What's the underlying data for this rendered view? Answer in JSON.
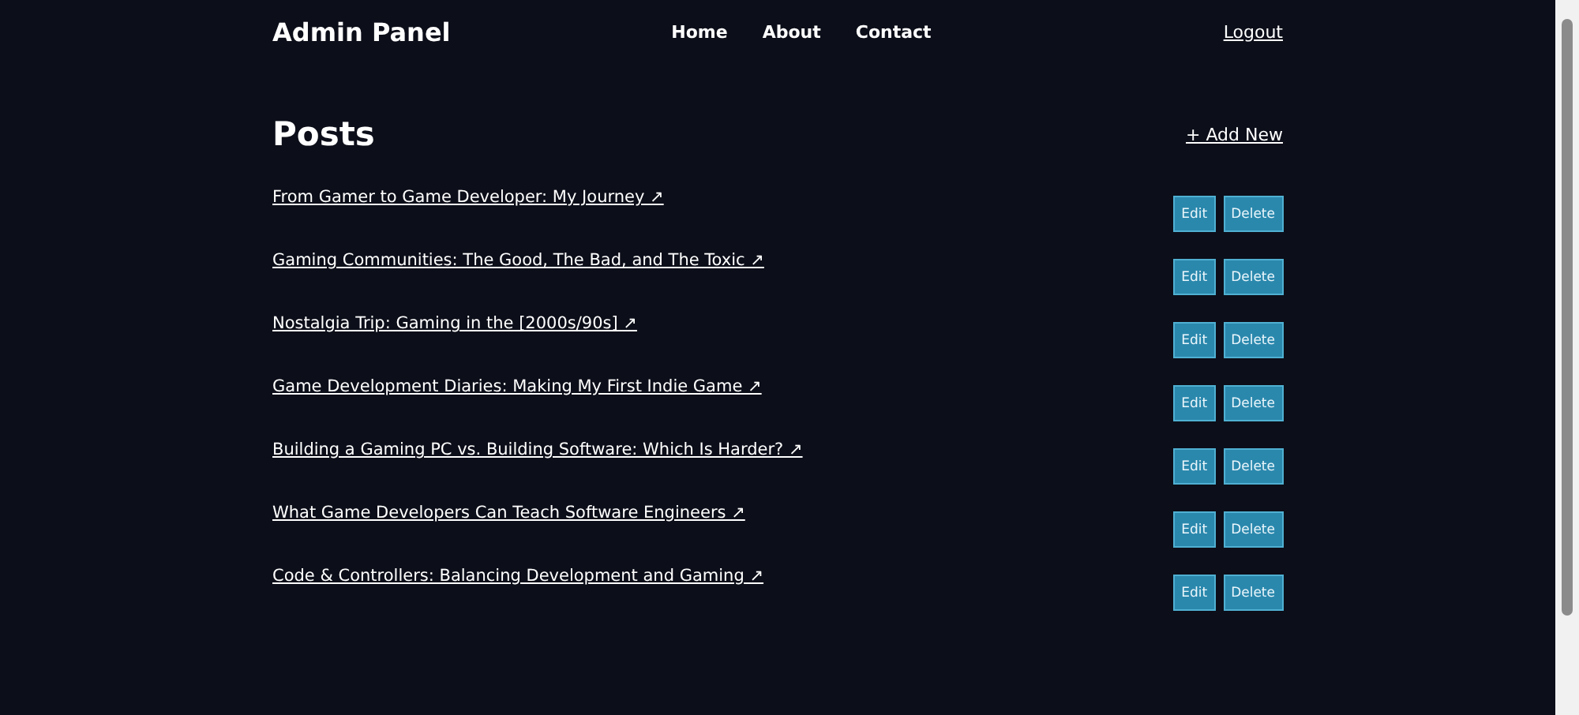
{
  "header": {
    "brand": "Admin Panel",
    "nav": [
      "Home",
      "About",
      "Contact"
    ],
    "logout": "Logout"
  },
  "page": {
    "title": "Posts",
    "add_new": "+ Add New"
  },
  "posts": [
    {
      "title": "From Gamer to Game Developer: My Journey ↗",
      "actions": [
        "Edit",
        "Delete"
      ]
    },
    {
      "title": "Gaming Communities: The Good, The Bad, and The Toxic ↗",
      "actions": [
        "Edit",
        "Delete"
      ]
    },
    {
      "title": "Nostalgia Trip: Gaming in the [2000s/90s] ↗",
      "actions": [
        "Edit",
        "Delete"
      ]
    },
    {
      "title": "Game Development Diaries: Making My First Indie Game ↗",
      "actions": [
        "Edit",
        "Delete"
      ]
    },
    {
      "title": "Building a Gaming PC vs. Building Software: Which Is Harder? ↗",
      "actions": [
        "Edit",
        "Delete"
      ]
    },
    {
      "title": "What Game Developers Can Teach Software Engineers ↗",
      "actions": [
        "Edit",
        "Delete"
      ]
    },
    {
      "title": "Code & Controllers: Balancing Development and Gaming ↗",
      "actions": [
        "Edit",
        "Delete"
      ]
    }
  ]
}
